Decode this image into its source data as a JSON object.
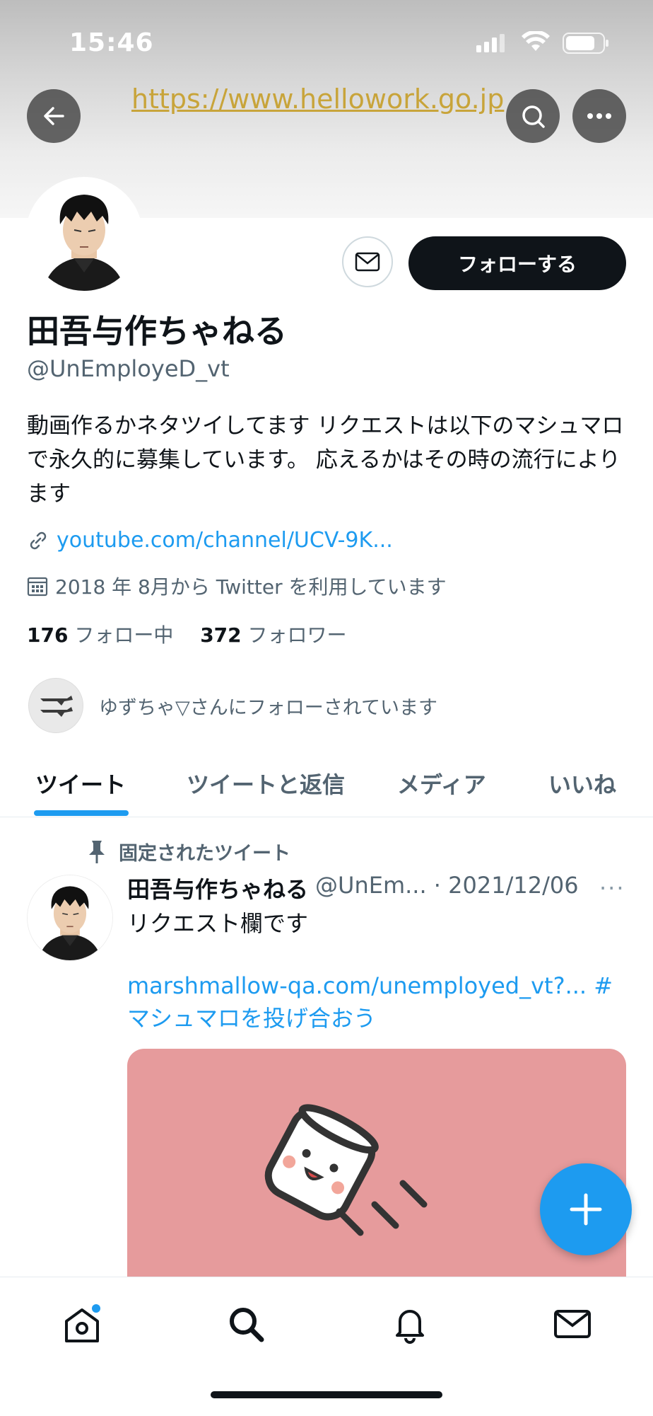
{
  "status_bar": {
    "time": "15:46"
  },
  "banner": {
    "url_text": "https://www.hellowork.go.jp"
  },
  "profile": {
    "follow_button": "フォローする",
    "display_name": "田吾与作ちゃねる",
    "handle": "@UnEmployeD_vt",
    "bio": "動画作るかネタツイしてます リクエストは以下のマシュマロで永久的に募集しています。 応えるかはその時の流行によります",
    "link": "youtube.com/channel/UCV-9K...",
    "joined": "2018 年 8月から Twitter を利用しています",
    "following_count": "176",
    "following_label": "フォロー中",
    "followers_count": "372",
    "followers_label": "フォロワー",
    "followed_by": "ゆずちゃ▽さんにフォローされています"
  },
  "tabs": [
    {
      "label": "ツイート",
      "active": true
    },
    {
      "label": "ツイートと返信",
      "active": false
    },
    {
      "label": "メディア",
      "active": false
    },
    {
      "label": "いいね",
      "active": false
    }
  ],
  "pinned_tweet": {
    "pinned_label": "固定されたツイート",
    "name": "田吾与作ちゃねる",
    "handle_date": "@UnEm... · 2021/12/06",
    "more": "···",
    "text": "リクエスト欄です",
    "links": "marshmallow-qa.com/unemployed_vt?... #マシュマロを投げ合おう"
  },
  "icons": {
    "back": "arrow-left-icon",
    "search": "search-icon",
    "more": "more-horizontal-icon",
    "message": "envelope-icon",
    "link": "link-icon",
    "calendar": "calendar-icon",
    "pin": "pin-icon",
    "compose": "plus-icon",
    "nav": [
      "home-icon",
      "search-icon",
      "bell-icon",
      "mail-icon"
    ]
  },
  "colors": {
    "accent": "#1d9bf0",
    "follow_button_bg": "#0f1419",
    "card_bg": "#e69b9c",
    "url_text": "#c8a43a"
  }
}
